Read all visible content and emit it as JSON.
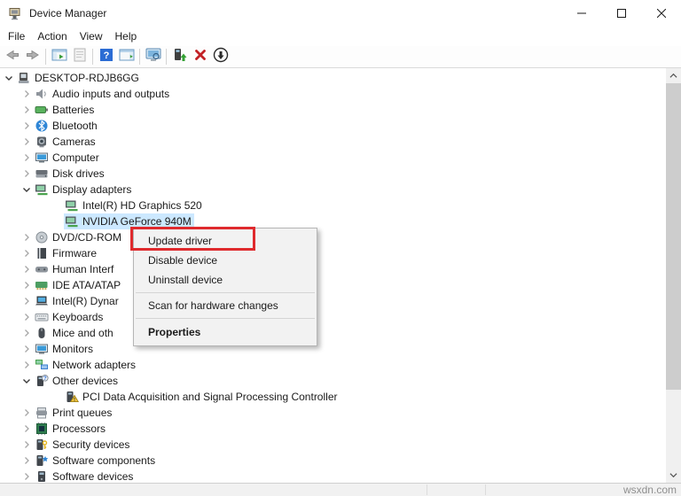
{
  "window": {
    "title": "Device Manager",
    "controls": [
      "minimize",
      "maximize",
      "close"
    ]
  },
  "menubar": {
    "items": [
      "File",
      "Action",
      "View",
      "Help"
    ]
  },
  "toolbar": {
    "items": [
      "back",
      "forward",
      "separator",
      "show-console-tree",
      "properties",
      "separator",
      "help",
      "show-action-pane",
      "separator",
      "remote-computer",
      "separator",
      "update-driver",
      "uninstall-device",
      "scan-hardware-changes"
    ]
  },
  "tree": {
    "rows": [
      {
        "level": 0,
        "expander": "expanded",
        "icon": "computer-root",
        "label": "DESKTOP-RDJB6GG",
        "selected": false
      },
      {
        "level": 1,
        "expander": "collapsed",
        "icon": "audio",
        "label": "Audio inputs and outputs",
        "selected": false
      },
      {
        "level": 1,
        "expander": "collapsed",
        "icon": "battery",
        "label": "Batteries",
        "selected": false
      },
      {
        "level": 1,
        "expander": "collapsed",
        "icon": "bluetooth",
        "label": "Bluetooth",
        "selected": false
      },
      {
        "level": 1,
        "expander": "collapsed",
        "icon": "camera",
        "label": "Cameras",
        "selected": false
      },
      {
        "level": 1,
        "expander": "collapsed",
        "icon": "computer",
        "label": "Computer",
        "selected": false
      },
      {
        "level": 1,
        "expander": "collapsed",
        "icon": "disk",
        "label": "Disk drives",
        "selected": false
      },
      {
        "level": 1,
        "expander": "expanded",
        "icon": "display",
        "label": "Display adapters",
        "selected": false
      },
      {
        "level": 2,
        "expander": "none",
        "icon": "display",
        "label": "Intel(R) HD Graphics 520",
        "selected": false
      },
      {
        "level": 2,
        "expander": "none",
        "icon": "display",
        "label": "NVIDIA GeForce 940M",
        "selected": true
      },
      {
        "level": 1,
        "expander": "collapsed",
        "icon": "dvd",
        "label": "DVD/CD-ROM",
        "selected": false
      },
      {
        "level": 1,
        "expander": "collapsed",
        "icon": "firmware",
        "label": "Firmware",
        "selected": false
      },
      {
        "level": 1,
        "expander": "collapsed",
        "icon": "hid",
        "label": "Human Interf",
        "selected": false
      },
      {
        "level": 1,
        "expander": "collapsed",
        "icon": "ide",
        "label": "IDE ATA/ATAP",
        "selected": false
      },
      {
        "level": 1,
        "expander": "collapsed",
        "icon": "laptop",
        "label": "Intel(R) Dynar",
        "selected": false
      },
      {
        "level": 1,
        "expander": "collapsed",
        "icon": "keyboard",
        "label": "Keyboards",
        "selected": false
      },
      {
        "level": 1,
        "expander": "collapsed",
        "icon": "mouse",
        "label": "Mice and oth",
        "selected": false
      },
      {
        "level": 1,
        "expander": "collapsed",
        "icon": "monitor",
        "label": "Monitors",
        "selected": false
      },
      {
        "level": 1,
        "expander": "collapsed",
        "icon": "network",
        "label": "Network adapters",
        "selected": false
      },
      {
        "level": 1,
        "expander": "expanded",
        "icon": "other-device",
        "label": "Other devices",
        "selected": false
      },
      {
        "level": 2,
        "expander": "none",
        "icon": "unknown-warning",
        "label": "PCI Data Acquisition and Signal Processing Controller",
        "selected": false
      },
      {
        "level": 1,
        "expander": "collapsed",
        "icon": "printer",
        "label": "Print queues",
        "selected": false
      },
      {
        "level": 1,
        "expander": "collapsed",
        "icon": "processor",
        "label": "Processors",
        "selected": false
      },
      {
        "level": 1,
        "expander": "collapsed",
        "icon": "security",
        "label": "Security devices",
        "selected": false
      },
      {
        "level": 1,
        "expander": "collapsed",
        "icon": "software-component",
        "label": "Software components",
        "selected": false
      },
      {
        "level": 1,
        "expander": "collapsed",
        "icon": "software-device",
        "label": "Software devices",
        "selected": false
      }
    ]
  },
  "context_menu": {
    "items": [
      {
        "label": "Update driver",
        "annotated": true
      },
      {
        "label": "Disable device"
      },
      {
        "label": "Uninstall device"
      },
      {
        "separator": true
      },
      {
        "label": "Scan for hardware changes"
      },
      {
        "separator": true
      },
      {
        "label": "Properties",
        "bold": true
      }
    ]
  },
  "colors": {
    "selection_highlight": "#cce8ff",
    "annotation_red": "#df2a2d",
    "menu_background": "#f2f2f2",
    "watermark_gray": "#8f8f8f"
  },
  "watermark": "wsxdn.com"
}
